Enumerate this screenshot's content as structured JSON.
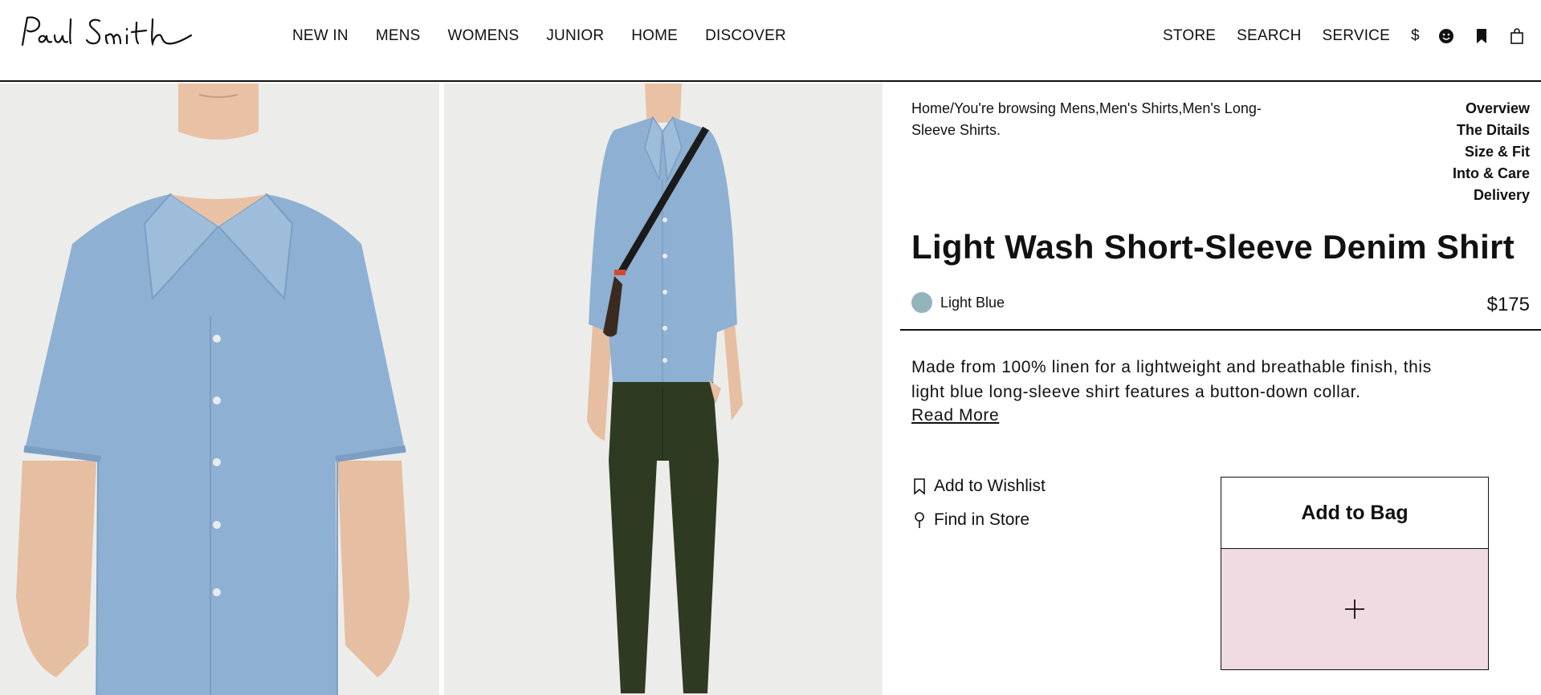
{
  "brand": {
    "logo_text": "Paul Smith"
  },
  "nav": {
    "left": [
      "NEW IN",
      "MENS",
      "WOMENS",
      "JUNIOR",
      "HOME",
      "DISCOVER"
    ],
    "right": [
      "STORE",
      "SEARCH",
      "SERVICE"
    ],
    "currency": "$",
    "icons": [
      "account-icon",
      "wishlist-bookmark-icon",
      "bag-icon"
    ]
  },
  "breadcrumb": {
    "text": "Home/You're browsing Mens,Men's Shirts,Men's Long-Sleeve Shirts."
  },
  "sections": [
    "Overview",
    "The Ditails",
    "Size & Fit",
    "Into & Care",
    "Delivery"
  ],
  "product": {
    "title": "Light Wash Short-Sleeve Denim Shirt",
    "color_name": "Light Blue",
    "color_hex": "#94b4bb",
    "price": "$175",
    "description": "Made from 100% linen for a lightweight and breathable finish, this light blue long-sleeve shirt features a button-down collar.",
    "read_more": "Read More"
  },
  "actions": {
    "wishlist": "Add to Wishlist",
    "find_store": "Find in Store",
    "add_to_bag": "Add to Bag"
  },
  "colors": {
    "accent_pink": "#efdbe1",
    "image_bg": "#ececea",
    "denim": "#8eb0d2",
    "trousers": "#2e3a22"
  }
}
